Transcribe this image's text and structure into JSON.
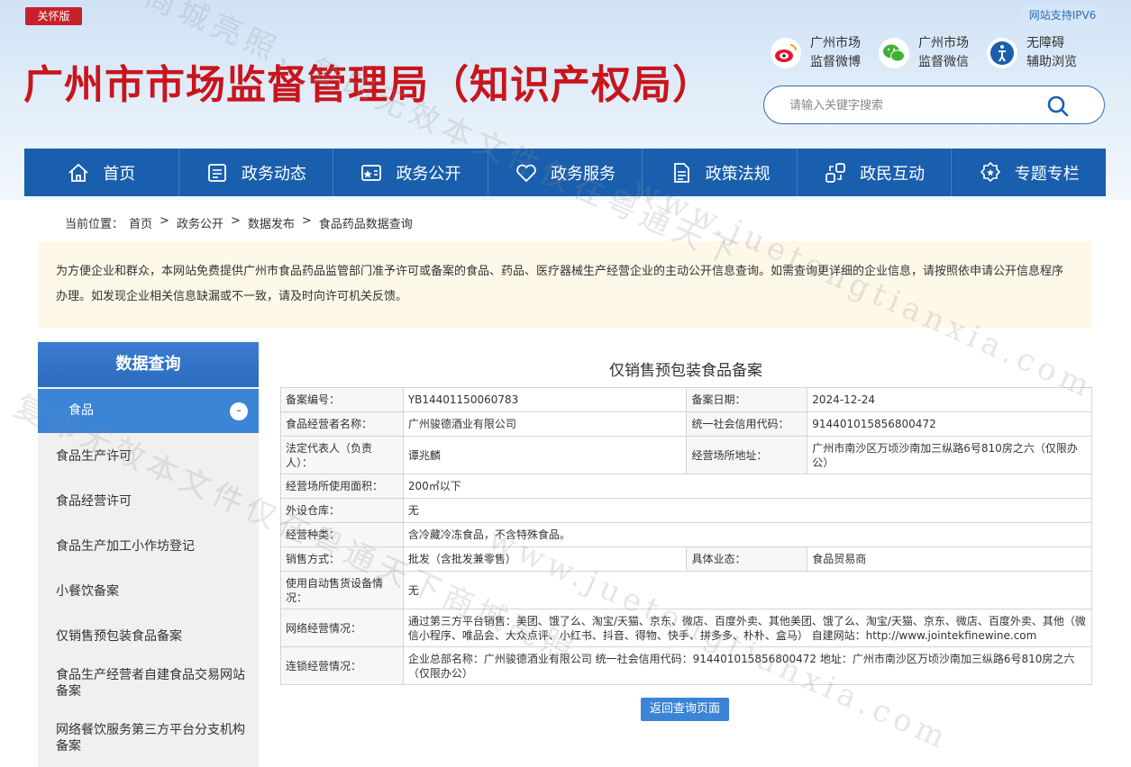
{
  "header": {
    "care_label": "关怀版",
    "ipv6_label": "网站支持IPV6",
    "site_title": "广州市市场监督管理局（知识产权局）",
    "quick_links": [
      {
        "icon": "weibo-icon",
        "line1": "广州市场",
        "line2": "监督微博"
      },
      {
        "icon": "wechat-icon",
        "line1": "广州市场",
        "line2": "监督微信"
      },
      {
        "icon": "accessibility-icon",
        "line1": "无障碍",
        "line2": "辅助浏览"
      }
    ],
    "search_placeholder": "请输入关键字搜索"
  },
  "nav": [
    {
      "label": "首页",
      "icon": "home-icon"
    },
    {
      "label": "政务动态",
      "icon": "news-icon"
    },
    {
      "label": "政务公开",
      "icon": "open-icon"
    },
    {
      "label": "政务服务",
      "icon": "heart-icon"
    },
    {
      "label": "政策法规",
      "icon": "document-icon"
    },
    {
      "label": "政民互动",
      "icon": "interact-icon"
    },
    {
      "label": "专题专栏",
      "icon": "badge-icon"
    }
  ],
  "breadcrumb": {
    "prefix": "当前位置：",
    "items": [
      "首页",
      "政务公开",
      "数据发布",
      "食品药品数据查询"
    ]
  },
  "notice": "为方便企业和群众，本网站免费提供广州市食品药品监管部门准予许可或备案的食品、药品、医疗器械生产经营企业的主动公开信息查询。如需查询更详细的企业信息，请按照依申请公开信息程序办理。如发现企业相关信息缺漏或不一致，请及时向许可机关反馈。",
  "sidebar": {
    "title": "数据查询",
    "active": "食品",
    "active_toggle": "-",
    "items": [
      "食品生产许可",
      "食品经营许可",
      "食品生产加工小作坊登记",
      "小餐饮备案",
      "仅销售预包装食品备案",
      "食品生产经营者自建食品交易网站备案",
      "网络餐饮服务第三方平台分支机构备案"
    ]
  },
  "record": {
    "title": "仅销售预包装食品备案",
    "rows": {
      "r1": {
        "l1": "备案编号：",
        "v1": "YB14401150060783",
        "l2": "备案日期：",
        "v2": "2024-12-24"
      },
      "r2": {
        "l1": "食品经营者名称：",
        "v1": "广州骏德酒业有限公司",
        "l2": "统一社会信用代码：",
        "v2": "91440101585680047​2"
      },
      "r3": {
        "l1": "法定代表人（负责人）：",
        "v1": "谭兆麟",
        "l2": "经营场所地址：",
        "v2": "广州市南沙区万顷沙南加三纵路6号810房之六（仅限办公）"
      },
      "r4": {
        "l": "经营场所使用面积：",
        "v": "200㎡以下"
      },
      "r5": {
        "l": "外设仓库：",
        "v": "无"
      },
      "r6": {
        "l": "经营种类：",
        "v": "含冷藏冷冻食品，不含特殊食品。"
      },
      "r7": {
        "l1": "销售方式：",
        "v1": "批发（含批发兼零售）",
        "l2": "具体业态：",
        "v2": "食品贸易商"
      },
      "r8": {
        "l": "使用自动售货设备情况：",
        "v": "无"
      },
      "r9": {
        "l": "网络经营情况：",
        "v": "通过第三方平台销售：美团、饿了么、淘宝/天猫、京东、微店、百度外卖、其他美团、饿了么、淘宝/天猫、京东、微店、百度外卖、其他（微信小程序、唯品会、大众点评、小红书、抖音、得物、快手、拼多多、朴朴、盒马） 自建网站：http://www.jointekfinewine.com"
      },
      "r10": {
        "l": "连锁经营情况：",
        "v": "企业总部名称：广州骏德酒业有限公司 统一社会信用代码：91440101585680047​2 地址：广州市南沙区万顷沙南加三纵路6号810房之六（仅限办公）"
      }
    },
    "back_label": "返回查询页面"
  },
  "watermarks": [
    "粤通天下商城亮照，复印无效本文件仅在粤通天下",
    "www.juetongtianxia.com",
    "复印无效本文件仅在粤通天下商城亮照",
    "www.juetongtianxia.com"
  ],
  "colors": {
    "brand_red": "#c8151d",
    "nav_blue": "#1a5fad",
    "accent_blue": "#3b84d6"
  }
}
